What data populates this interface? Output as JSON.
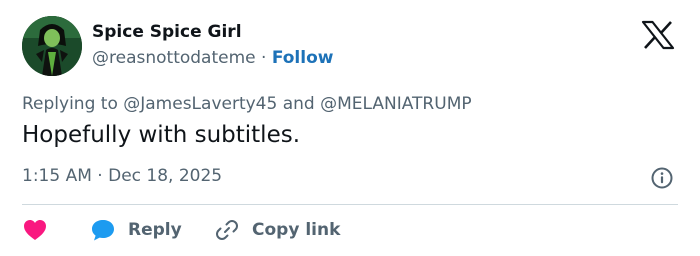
{
  "author": {
    "display_name": "Spice Spice Girl",
    "handle": "@reasnottodateme",
    "separator": "·",
    "follow_label": "Follow",
    "avatar_icon": "cartoon-character-avatar"
  },
  "brand": {
    "logo_icon": "x-logo"
  },
  "reply_context": {
    "prefix": "Replying to",
    "mentions": [
      "@JamesLaverty45",
      "@MELANIATRUMP"
    ],
    "conjunction": "and"
  },
  "tweet": {
    "text": "Hopefully with subtitles.",
    "time": "1:15 AM",
    "separator": "·",
    "date": "Dec 18, 2025",
    "info_icon": "info-icon"
  },
  "actions": {
    "like_icon": "heart-icon",
    "reply_label": "Reply",
    "reply_icon": "speech-bubble-icon",
    "copy_label": "Copy link",
    "copy_icon": "link-icon"
  },
  "colors": {
    "text": "#0f1419",
    "secondary": "#536471",
    "follow": "#1d72b8",
    "like": "#f91880",
    "reply": "#1d9bf0",
    "divider": "#cfd9de"
  }
}
